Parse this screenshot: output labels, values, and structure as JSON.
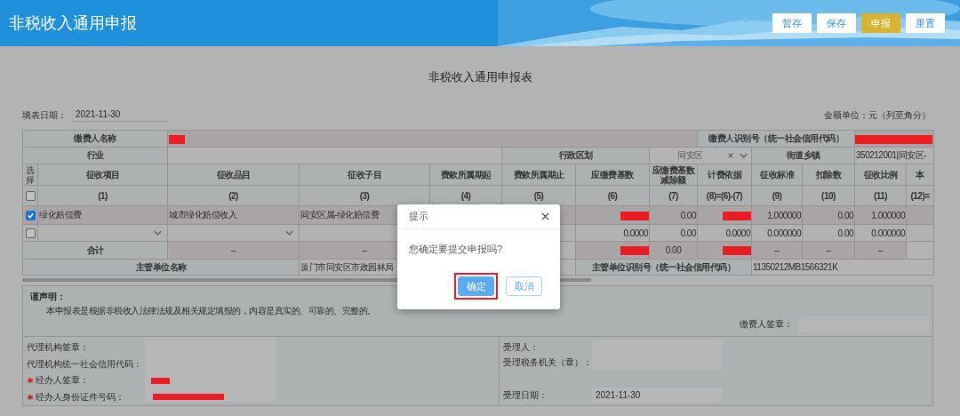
{
  "header": {
    "title": "非税收入通用申报",
    "buttons": [
      {
        "label": "暂存",
        "kind": "plain"
      },
      {
        "label": "保存",
        "kind": "plain"
      },
      {
        "label": "申报",
        "kind": "primary"
      },
      {
        "label": "重置",
        "kind": "plain"
      }
    ]
  },
  "form": {
    "title": "非税收入通用申报表",
    "fill_date_label": "填表日期：",
    "fill_date": "2021-11-30",
    "unit_note": "金额单位：元（列至角分）"
  },
  "payer": {
    "name_label": "缴费人名称",
    "name_redacted": true,
    "id_label": "缴费人识别号（统一社会信用代码）",
    "id_redacted": true,
    "industry_label": "行业",
    "district_label": "行政区划",
    "district": "同安区",
    "street_label": "街道乡镇",
    "street": "350212001|同安区-"
  },
  "table": {
    "select_label": "选择",
    "columns": [
      "征收项目",
      "征收品目",
      "征收子目",
      "费款所属期起",
      "费款所属期止",
      "应缴费基数",
      "应缴费基数减除额",
      "计费依据",
      "征收标准",
      "扣除数",
      "征收比例",
      "本"
    ],
    "numbers": [
      "(1)",
      "(2)",
      "(3)",
      "(4)",
      "(5)",
      "(6)",
      "(7)",
      "(8)=(6)-(7)",
      "(9)",
      "(10)",
      "(11)",
      "(12)="
    ],
    "select_all_checked": false,
    "rows": [
      {
        "checked": true,
        "cells": [
          {
            "kind": "text",
            "text": "绿化赔偿费"
          },
          {
            "kind": "text",
            "text": "城市绿化赔偿收入"
          },
          {
            "kind": "text",
            "text": "同安区属-绿化赔偿费"
          },
          {
            "kind": "blank"
          },
          {
            "kind": "blank"
          },
          {
            "kind": "redacted"
          },
          {
            "kind": "text",
            "text": "0.00"
          },
          {
            "kind": "redacted"
          },
          {
            "kind": "text",
            "text": "1.000000"
          },
          {
            "kind": "text",
            "text": "0.00"
          },
          {
            "kind": "text",
            "text": "1.000000"
          },
          {
            "kind": "blank"
          }
        ]
      },
      {
        "checked": false,
        "cells": [
          {
            "kind": "select"
          },
          {
            "kind": "select"
          },
          {
            "kind": "blank"
          },
          {
            "kind": "blank"
          },
          {
            "kind": "blank"
          },
          {
            "kind": "text",
            "text": "0.0000"
          },
          {
            "kind": "text",
            "text": "0.00"
          },
          {
            "kind": "text",
            "text": "0.0000"
          },
          {
            "kind": "text",
            "text": "0.000000"
          },
          {
            "kind": "text",
            "text": "0.00"
          },
          {
            "kind": "text",
            "text": "0.000000"
          },
          {
            "kind": "blank"
          }
        ]
      }
    ],
    "total": {
      "label": "合计",
      "cells": [
        {
          "kind": "text",
          "text": "--"
        },
        {
          "kind": "text",
          "text": "--"
        },
        {
          "kind": "blank"
        },
        {
          "kind": "blank"
        },
        {
          "kind": "redacted"
        },
        {
          "kind": "text",
          "text": "0.00"
        },
        {
          "kind": "redacted"
        },
        {
          "kind": "text",
          "text": "--"
        },
        {
          "kind": "text",
          "text": "--"
        },
        {
          "kind": "text",
          "text": "--"
        },
        {
          "kind": "blank"
        }
      ]
    },
    "authority": {
      "name_label": "主管单位名称",
      "name": "厦门市同安区市政园林局",
      "id_label": "主管单位识别号（统一社会信用代码）",
      "id": "11350212MB1566321K"
    }
  },
  "declaration": {
    "title": "谨声明：",
    "text": "本申报表是根据非税收入法律法规及相关规定填报的，内容是真实的、可靠的、完整的。",
    "signature_label": "缴费人签章："
  },
  "agent": [
    {
      "label": "代理机构签章：",
      "required": false
    },
    {
      "label": "代理机构统一社会信用代码：",
      "required": false
    },
    {
      "label": "经办人签章：",
      "required": true,
      "redacted": true
    },
    {
      "label": "经办人身份证件号码：",
      "required": true,
      "redacted": true
    }
  ],
  "receiver": [
    {
      "label": "受理人：",
      "kind": "field"
    },
    {
      "label": "受理税务机关（章）：",
      "kind": "field"
    },
    {
      "label": "受理日期：",
      "kind": "date",
      "value": "2021-11-30"
    }
  ],
  "dialog": {
    "title": "提示",
    "message": "您确定要提交申报吗?",
    "buttons": [
      {
        "label": "确定",
        "kind": "primary",
        "highlighted": true
      },
      {
        "label": "取消",
        "kind": "plain",
        "highlighted": false
      }
    ]
  }
}
